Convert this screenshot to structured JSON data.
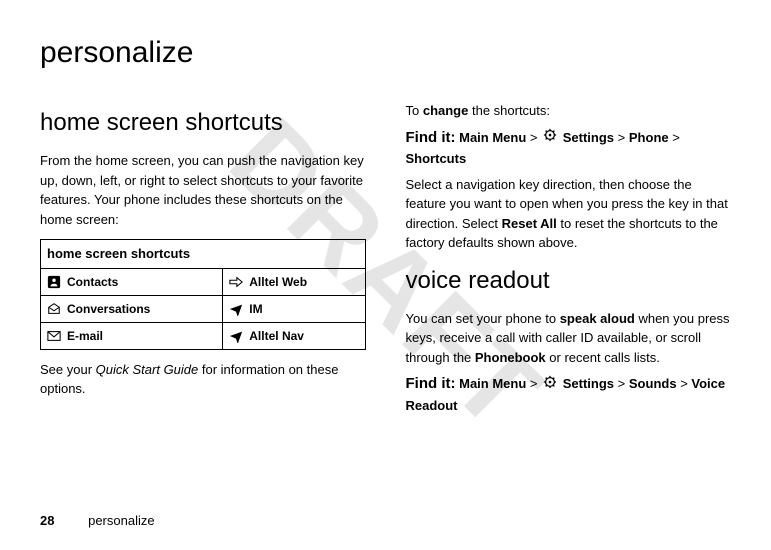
{
  "watermark": "DRAFT",
  "page_title": "personalize",
  "left": {
    "section_title": "home screen shortcuts",
    "intro": "From the home screen, you can push the navigation key up, down, left, or right to select shortcuts to your favorite features. Your phone includes these shortcuts on the home screen:",
    "table_header": "home screen shortcuts",
    "rows": [
      {
        "l": "Contacts",
        "r": "Alltel Web"
      },
      {
        "l": "Conversations",
        "r": "IM"
      },
      {
        "l": "E-mail",
        "r": "Alltel Nav"
      }
    ],
    "post_table_1": "See your ",
    "post_table_em": "Quick Start Guide",
    "post_table_2": " for information on these options."
  },
  "right": {
    "change_pre": "To ",
    "change_bold": "change",
    "change_post": " the shortcuts:",
    "find_it_label": "Find it:",
    "path1_a": "Main Menu",
    "path1_b": "Settings",
    "path1_c": "Phone",
    "path1_d": "Shortcuts",
    "gt": ">",
    "paragraph": "Select a navigation key direction, then choose the feature you want to open when you press the key in that direction. Select ",
    "reset_all": "Reset All",
    "paragraph2": " to reset the shortcuts to the factory defaults shown above.",
    "section_title": "voice readout",
    "voice_p1a": "You can set your phone to ",
    "voice_bold": "speak aloud",
    "voice_p1b": " when you press keys, receive a call with caller ID available, or scroll through the ",
    "phonebook": "Phonebook",
    "voice_p1c": " or recent calls lists.",
    "path2_a": "Main Menu",
    "path2_b": "Settings",
    "path2_c": "Sounds",
    "path2_d": "Voice Readout"
  },
  "footer": {
    "page": "28",
    "section": "personalize"
  }
}
